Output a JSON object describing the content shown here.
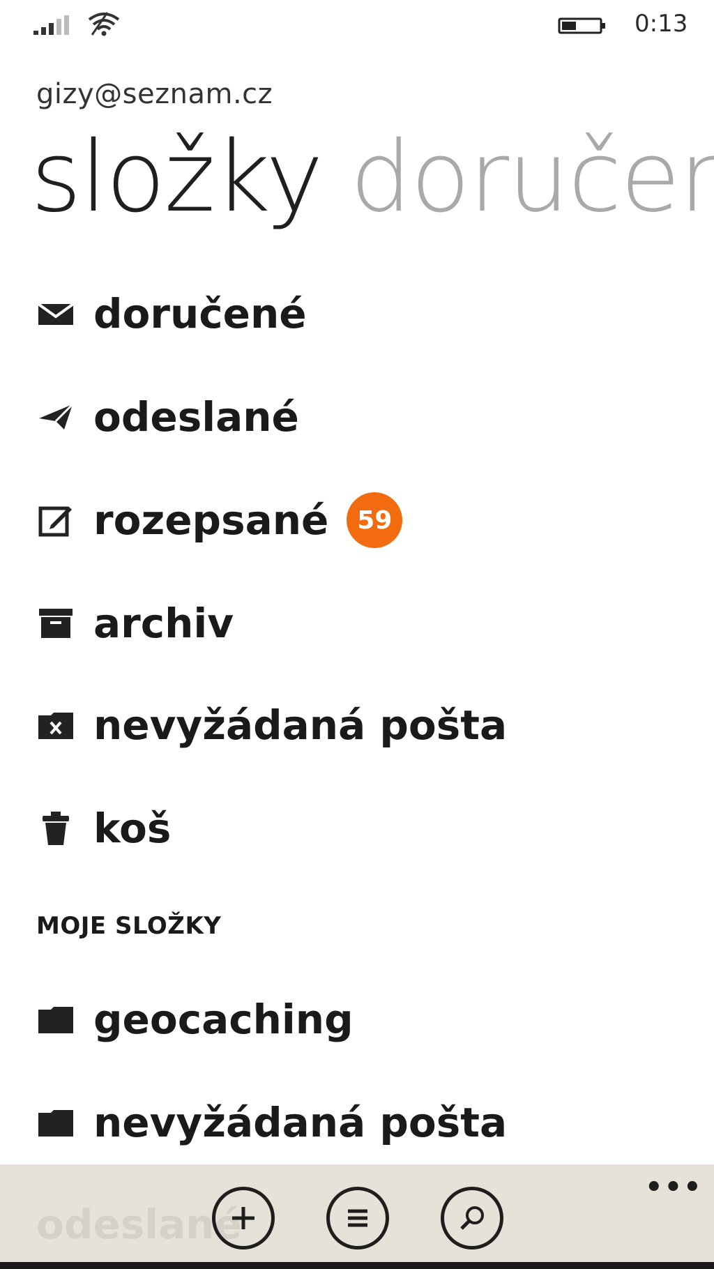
{
  "status_bar": {
    "time": "0:13",
    "icons": [
      "signal-icon",
      "wifi-icon",
      "battery-icon"
    ]
  },
  "account": "gizy@seznam.cz",
  "pivot": {
    "active": "složky",
    "next": "doručen"
  },
  "folders": [
    {
      "label": "doručené",
      "icon": "inbox-envelope-icon"
    },
    {
      "label": "odeslané",
      "icon": "sent-paper-plane-icon"
    },
    {
      "label": "rozepsané",
      "icon": "drafts-edit-icon",
      "badge": "59"
    },
    {
      "label": "archiv",
      "icon": "archive-box-icon"
    },
    {
      "label": "nevyžádaná pošta",
      "icon": "junk-folder-icon"
    },
    {
      "label": "koš",
      "icon": "trash-icon"
    }
  ],
  "my_folders": {
    "header": "MOJE SLOŽKY",
    "items": [
      {
        "label": "geocaching",
        "icon": "folder-icon"
      },
      {
        "label": "nevyžádaná pošta",
        "icon": "folder-icon"
      }
    ],
    "partial_item": "odeslané"
  },
  "app_bar": {
    "buttons": [
      "add-icon",
      "list-icon",
      "search-icon"
    ],
    "more": "•••"
  },
  "colors": {
    "badge": "#f26b0f",
    "app_bar": "#e7e2d7",
    "inactive_pivot": "#a9a9a9"
  }
}
